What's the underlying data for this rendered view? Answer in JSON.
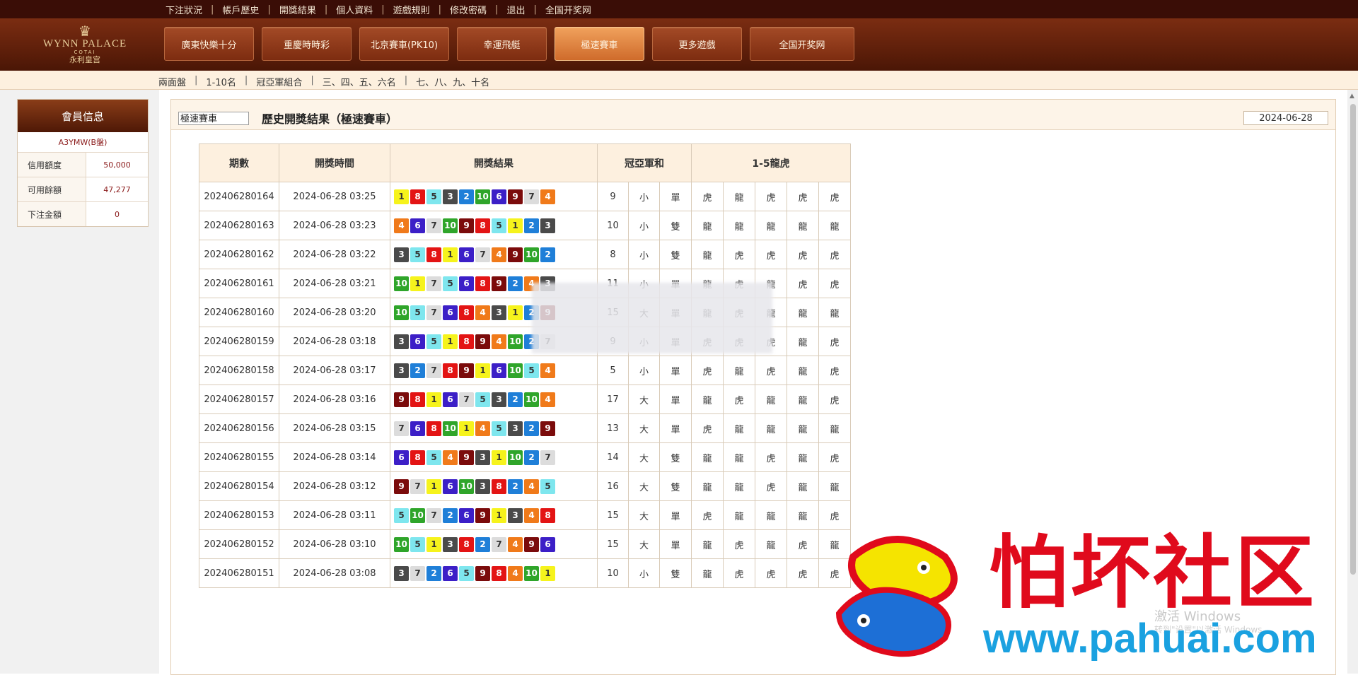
{
  "top_links": [
    "下注狀況",
    "帳戶歷史",
    "開獎結果",
    "個人資料",
    "遊戲規則",
    "修改密碼",
    "退出",
    "全国开奖网"
  ],
  "logo": {
    "brand": "WYNN PALACE",
    "sub": "COTAI",
    "cn": "永利皇宫"
  },
  "main_nav": [
    {
      "label": "廣東快樂十分",
      "active": false
    },
    {
      "label": "重慶時時彩",
      "active": false
    },
    {
      "label": "北京賽車(PK10)",
      "active": false
    },
    {
      "label": "幸運飛艇",
      "active": false
    },
    {
      "label": "極速賽車",
      "active": true
    },
    {
      "label": "更多遊戲",
      "active": false
    },
    {
      "label": "全国开奖网",
      "active": false
    }
  ],
  "sub_nav": [
    "兩面盤",
    "1-10名",
    "冠亞軍組合",
    "三、四、五、六名",
    "七、八、九、十名"
  ],
  "member": {
    "title": "會員信息",
    "name": "A3YMW(B盤)",
    "rows": [
      {
        "label": "信用額度",
        "value": "50,000"
      },
      {
        "label": "可用餘額",
        "value": "47,277"
      },
      {
        "label": "下注金額",
        "value": "0"
      }
    ]
  },
  "main": {
    "game_select": "極速賽車",
    "title": "歷史開獎結果（極速賽車）",
    "date": "2024-06-28"
  },
  "table": {
    "headers": {
      "period": "期數",
      "time": "開獎時間",
      "result": "開獎結果",
      "gy": "冠亞軍和",
      "dt": "1-5龍虎"
    },
    "ball_colors": {
      "1": {
        "bg": "#f6f31c",
        "fg": "#333333"
      },
      "2": {
        "bg": "#1f7fd8",
        "fg": "#ffffff"
      },
      "3": {
        "bg": "#4a4a4a",
        "fg": "#ffffff"
      },
      "4": {
        "bg": "#f07a1a",
        "fg": "#ffffff"
      },
      "5": {
        "bg": "#7ee6ee",
        "fg": "#333333"
      },
      "6": {
        "bg": "#3c1fc7",
        "fg": "#ffffff"
      },
      "7": {
        "bg": "#dcdcdc",
        "fg": "#333333"
      },
      "8": {
        "bg": "#e31414",
        "fg": "#ffffff"
      },
      "9": {
        "bg": "#7b0b0b",
        "fg": "#ffffff"
      },
      "10": {
        "bg": "#2fa52a",
        "fg": "#ffffff"
      }
    },
    "rows": [
      {
        "period": "202406280164",
        "time": "2024-06-28 03:25",
        "balls": [
          1,
          8,
          5,
          3,
          2,
          10,
          6,
          9,
          7,
          4
        ],
        "sum": "9",
        "bs": "小",
        "oe": "單",
        "dt": [
          "虎",
          "龍",
          "虎",
          "虎",
          "虎"
        ]
      },
      {
        "period": "202406280163",
        "time": "2024-06-28 03:23",
        "balls": [
          4,
          6,
          7,
          10,
          9,
          8,
          5,
          1,
          2,
          3
        ],
        "sum": "10",
        "bs": "小",
        "oe": "雙",
        "dt": [
          "龍",
          "龍",
          "龍",
          "龍",
          "龍"
        ]
      },
      {
        "period": "202406280162",
        "time": "2024-06-28 03:22",
        "balls": [
          3,
          5,
          8,
          1,
          6,
          7,
          4,
          9,
          10,
          2
        ],
        "sum": "8",
        "bs": "小",
        "oe": "雙",
        "dt": [
          "龍",
          "虎",
          "虎",
          "虎",
          "虎"
        ]
      },
      {
        "period": "202406280161",
        "time": "2024-06-28 03:21",
        "balls": [
          10,
          1,
          7,
          5,
          6,
          8,
          9,
          2,
          4,
          3
        ],
        "sum": "11",
        "bs": "小",
        "oe": "單",
        "dt": [
          "龍",
          "虎",
          "龍",
          "虎",
          "虎"
        ]
      },
      {
        "period": "202406280160",
        "time": "2024-06-28 03:20",
        "balls": [
          10,
          5,
          7,
          6,
          8,
          4,
          3,
          1,
          2,
          9
        ],
        "sum": "15",
        "bs": "大",
        "oe": "單",
        "dt": [
          "龍",
          "虎",
          "龍",
          "龍",
          "龍"
        ]
      },
      {
        "period": "202406280159",
        "time": "2024-06-28 03:18",
        "balls": [
          3,
          6,
          5,
          1,
          8,
          9,
          4,
          10,
          2,
          7
        ],
        "sum": "9",
        "bs": "小",
        "oe": "單",
        "dt": [
          "虎",
          "虎",
          "虎",
          "龍",
          "虎"
        ]
      },
      {
        "period": "202406280158",
        "time": "2024-06-28 03:17",
        "balls": [
          3,
          2,
          7,
          8,
          9,
          1,
          6,
          10,
          5,
          4
        ],
        "sum": "5",
        "bs": "小",
        "oe": "單",
        "dt": [
          "虎",
          "龍",
          "虎",
          "龍",
          "虎"
        ]
      },
      {
        "period": "202406280157",
        "time": "2024-06-28 03:16",
        "balls": [
          9,
          8,
          1,
          6,
          7,
          5,
          3,
          2,
          10,
          4
        ],
        "sum": "17",
        "bs": "大",
        "oe": "單",
        "dt": [
          "龍",
          "虎",
          "龍",
          "龍",
          "虎"
        ]
      },
      {
        "period": "202406280156",
        "time": "2024-06-28 03:15",
        "balls": [
          7,
          6,
          8,
          10,
          1,
          4,
          5,
          3,
          2,
          9
        ],
        "sum": "13",
        "bs": "大",
        "oe": "單",
        "dt": [
          "虎",
          "龍",
          "龍",
          "龍",
          "龍"
        ]
      },
      {
        "period": "202406280155",
        "time": "2024-06-28 03:14",
        "balls": [
          6,
          8,
          5,
          4,
          9,
          3,
          1,
          10,
          2,
          7
        ],
        "sum": "14",
        "bs": "大",
        "oe": "雙",
        "dt": [
          "龍",
          "龍",
          "虎",
          "龍",
          "虎"
        ]
      },
      {
        "period": "202406280154",
        "time": "2024-06-28 03:12",
        "balls": [
          9,
          7,
          1,
          6,
          10,
          3,
          8,
          2,
          4,
          5
        ],
        "sum": "16",
        "bs": "大",
        "oe": "雙",
        "dt": [
          "龍",
          "龍",
          "虎",
          "龍",
          "龍"
        ]
      },
      {
        "period": "202406280153",
        "time": "2024-06-28 03:11",
        "balls": [
          5,
          10,
          7,
          2,
          6,
          9,
          1,
          3,
          4,
          8
        ],
        "sum": "15",
        "bs": "大",
        "oe": "單",
        "dt": [
          "虎",
          "龍",
          "龍",
          "龍",
          "虎"
        ]
      },
      {
        "period": "202406280152",
        "time": "2024-06-28 03:10",
        "balls": [
          10,
          5,
          1,
          3,
          8,
          2,
          7,
          4,
          9,
          6
        ],
        "sum": "15",
        "bs": "大",
        "oe": "單",
        "dt": [
          "龍",
          "虎",
          "龍",
          "虎",
          "龍"
        ]
      },
      {
        "period": "202406280151",
        "time": "2024-06-28 03:08",
        "balls": [
          3,
          7,
          2,
          6,
          5,
          9,
          8,
          4,
          10,
          1
        ],
        "sum": "10",
        "bs": "小",
        "oe": "雙",
        "dt": [
          "龍",
          "虎",
          "虎",
          "虎",
          "虎"
        ]
      }
    ]
  },
  "watermark": {
    "cn": "怕坏社区",
    "url": "www.pahuai.com"
  },
  "windows": {
    "title": "激活 Windows",
    "sub": "转到\"设置\"以激活 Windows。"
  }
}
